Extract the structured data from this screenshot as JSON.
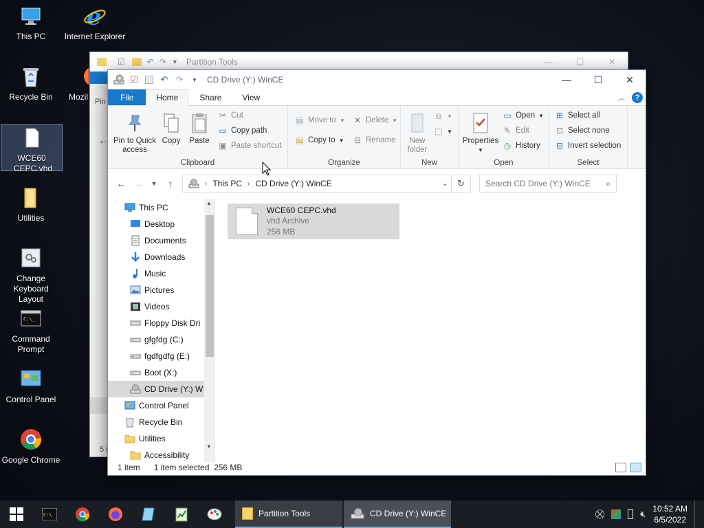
{
  "desktop": {
    "icons": [
      {
        "label": "This PC"
      },
      {
        "label": "Internet Explorer"
      },
      {
        "label": "Recycle Bin"
      },
      {
        "label": "Mozil"
      },
      {
        "label": "WCE60 CEPC.vhd"
      },
      {
        "label": "Utilities"
      },
      {
        "label": "Change Keyboard Layout"
      },
      {
        "label": "Command Prompt"
      },
      {
        "label": "Control Panel"
      },
      {
        "label": "Google Chrome"
      }
    ]
  },
  "back_window": {
    "title": "Partition Tools",
    "peek_pin": "Pin",
    "peek_count": "5 i"
  },
  "window": {
    "title": "CD Drive (Y:) WinCE",
    "tabs": [
      "File",
      "Home",
      "Share",
      "View"
    ],
    "ribbon": {
      "clipboard": {
        "label": "Clipboard",
        "pin": "Pin to Quick access",
        "copy": "Copy",
        "paste": "Paste",
        "cut": "Cut",
        "copy_path": "Copy path",
        "paste_shortcut": "Paste shortcut"
      },
      "organize": {
        "label": "Organize",
        "move_to": "Move to",
        "copy_to": "Copy to",
        "delete": "Delete",
        "rename": "Rename"
      },
      "new": {
        "label": "New",
        "new_folder": "New folder"
      },
      "open": {
        "label": "Open",
        "properties": "Properties",
        "open": "Open",
        "edit": "Edit",
        "history": "History"
      },
      "select": {
        "label": "Select",
        "select_all": "Select all",
        "select_none": "Select none",
        "invert": "Invert selection"
      }
    },
    "address": {
      "crumbs": [
        "This PC",
        "CD Drive (Y:) WinCE"
      ],
      "search_placeholder": "Search CD Drive (Y:) WinCE"
    },
    "nav_items": [
      {
        "label": "This PC",
        "icon": "pc-icon"
      },
      {
        "label": "Desktop",
        "icon": "desktop-icon"
      },
      {
        "label": "Documents",
        "icon": "documents-icon"
      },
      {
        "label": "Downloads",
        "icon": "downloads-icon"
      },
      {
        "label": "Music",
        "icon": "music-icon"
      },
      {
        "label": "Pictures",
        "icon": "pictures-icon"
      },
      {
        "label": "Videos",
        "icon": "videos-icon"
      },
      {
        "label": "Floppy Disk Dri",
        "icon": "floppy-icon"
      },
      {
        "label": "gfgfdg (C:)",
        "icon": "drive-icon"
      },
      {
        "label": "fgdfgdfg (E:)",
        "icon": "drive-icon"
      },
      {
        "label": "Boot (X:)",
        "icon": "drive-icon"
      },
      {
        "label": "CD Drive (Y:) W",
        "icon": "cd-drive-icon"
      },
      {
        "label": "Control Panel",
        "icon": "control-panel-icon"
      },
      {
        "label": "Recycle Bin",
        "icon": "recycle-bin-icon"
      },
      {
        "label": "Utilities",
        "icon": "folder-icon"
      },
      {
        "label": "Accessibility",
        "icon": "folder-icon"
      }
    ],
    "file": {
      "name": "WCE60 CEPC.vhd",
      "type": "vhd Archive",
      "size": "256 MB"
    },
    "status": {
      "count": "1 item",
      "selected": "1 item selected",
      "size": "256 MB"
    }
  },
  "taskbar": {
    "apps": [
      {
        "label": "Partition Tools"
      },
      {
        "label": "CD Drive (Y:) WinCE"
      }
    ],
    "time": "10:52 AM",
    "date": "6/5/2022"
  },
  "colors": {
    "accent": "#1979ca",
    "selection": "#d9d9d9"
  }
}
